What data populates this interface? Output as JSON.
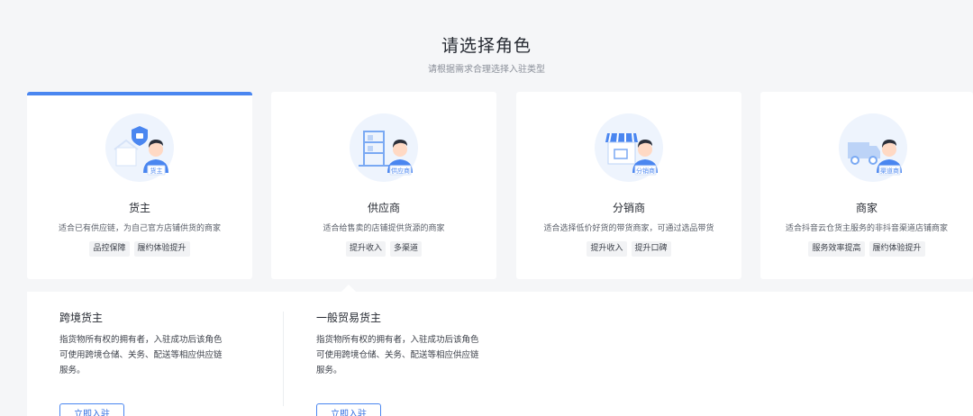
{
  "header": {
    "title": "请选择角色",
    "subtitle": "请根据需求合理选择入驻类型"
  },
  "roles": [
    {
      "name": "货主",
      "desc": "适合已有供应链，为自己官方店铺供货的商家",
      "tags": [
        "品控保障",
        "履约体验提升"
      ],
      "badge": "货主",
      "icon": "shield-icon",
      "active": true
    },
    {
      "name": "供应商",
      "desc": "适合给售卖的店铺提供货源的商家",
      "tags": [
        "提升收入",
        "多渠道"
      ],
      "badge": "供应商",
      "icon": "warehouse-icon",
      "active": false
    },
    {
      "name": "分销商",
      "desc": "适合选择低价好货的带货商家，可通过选品带货",
      "tags": [
        "提升收入",
        "提升口碑"
      ],
      "badge": "分销商",
      "icon": "storefront-icon",
      "active": false
    },
    {
      "name": "商家",
      "desc": "适合抖音云仓货主服务的非抖音渠道店铺商家",
      "tags": [
        "服务效率提高",
        "履约体验提升"
      ],
      "badge": "渠道商",
      "icon": "truck-icon",
      "active": false
    }
  ],
  "panel": {
    "options": [
      {
        "title": "跨境货主",
        "desc_lines": [
          "指货物所有权的拥有者，入驻成功后该角色",
          "可使用跨境仓储、关务、配送等相应供应链",
          "服务。"
        ],
        "button": "立即入驻"
      },
      {
        "title": "一般贸易货主",
        "desc_lines": [
          "指货物所有权的拥有者，入驻成功后该角色",
          "可使用跨境仓储、关务、配送等相应供应链",
          "服务。"
        ],
        "button": "立即入驻"
      }
    ]
  },
  "colors": {
    "accent": "#4a86f0",
    "background": "#f5f6f8",
    "card": "#ffffff"
  }
}
